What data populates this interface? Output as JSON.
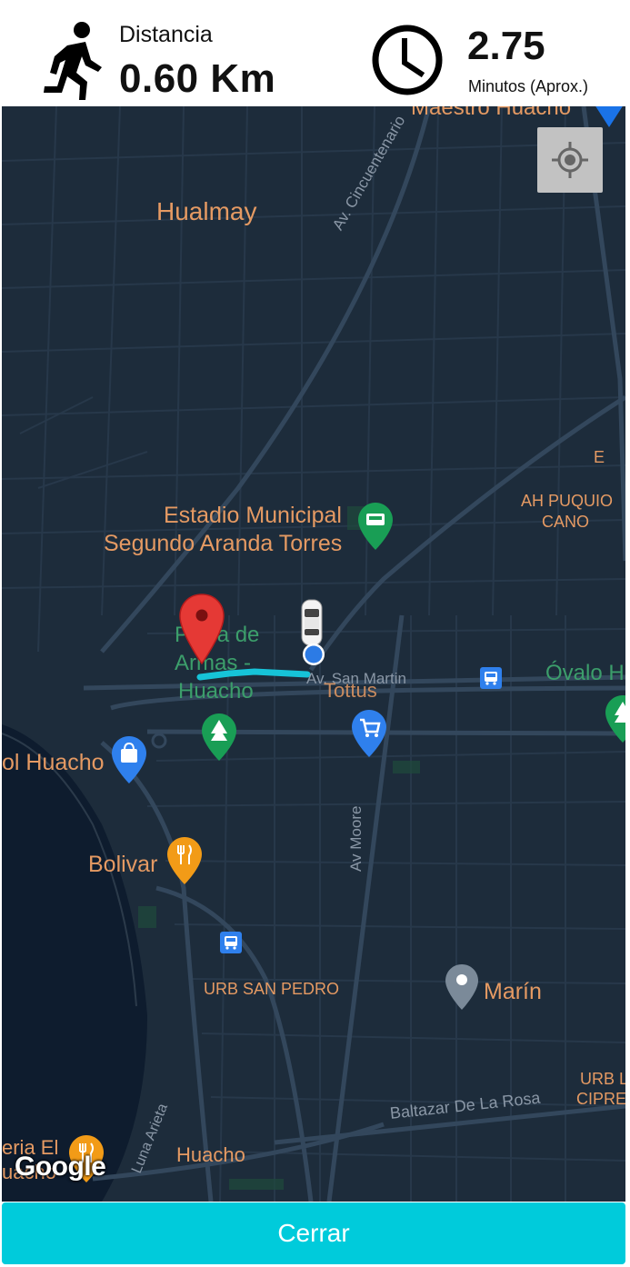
{
  "header": {
    "distance_label": "Distancia",
    "distance_value": "0.60 Km",
    "time_value": "2.75",
    "time_label": "Minutos (Aprox.)",
    "runner_icon": "running-person-icon",
    "clock_icon": "clock-icon"
  },
  "map": {
    "labels": {
      "maestro": "Maestro Huacho",
      "hualmay": "Hualmay",
      "cincuentenario": "Av. Cincuentenario",
      "estadio_1": "Estadio Municipal",
      "estadio_2": "Segundo Aranda Torres",
      "e": "E",
      "ah_1": "AH PUQUIO",
      "ah_2": "CANO",
      "plaza_1": "Plaza de",
      "plaza_2": "Armas -",
      "plaza_3": "Huacho",
      "san_martin": "Av. San Martin",
      "tottus": "Tottus",
      "ovalo": "Óvalo H",
      "mall": "ol Huacho",
      "moore": "Av Moore",
      "bolivar": "Bolivar",
      "urb_san_pedro": "URB SAN PEDRO",
      "marin": "Marín",
      "urb_1": "URB L",
      "urb_2": "CIPRE",
      "baltazar": "Baltazar De La Rosa",
      "arieta": "Luna Arieta",
      "huacho": "Huacho",
      "eria_1": "eria El",
      "eria_2": "uacho"
    },
    "google_logo": "Google",
    "locate_icon": "my-location-icon",
    "colors": {
      "background": "#1d2c3b",
      "route": "#16c3d8",
      "pin_red": "#e53935",
      "user_dot": "#2c7be5"
    }
  },
  "footer": {
    "close_label": "Cerrar",
    "color": "#00cbdb"
  }
}
